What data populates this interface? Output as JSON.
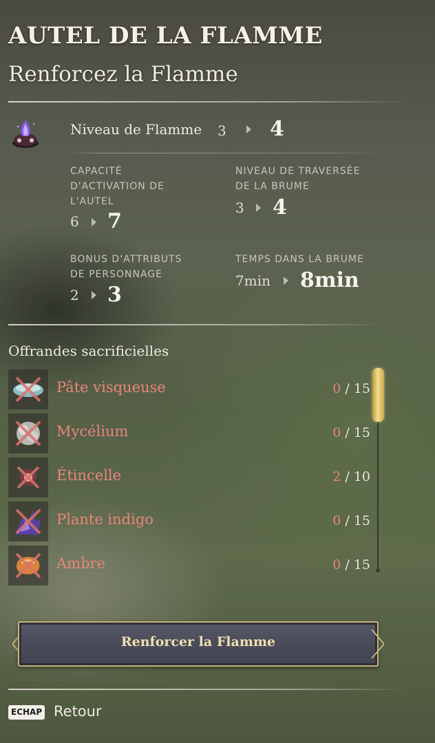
{
  "header": {
    "title": "AUTEL DE LA FLAMME",
    "subtitle": "Renforcez la Flamme"
  },
  "flame_level": {
    "label": "Niveau de Flamme",
    "old": "3",
    "new": "4",
    "icon": "flame-altar-icon"
  },
  "stats": [
    {
      "label": "CAPACITÉ\nD'ACTIVATION DE\nL'AUTEL",
      "old": "6",
      "new": "7"
    },
    {
      "label": "NIVEAU DE TRAVERSÉE\nDE LA BRUME",
      "old": "3",
      "new": "4"
    },
    {
      "label": "BONUS D'ATTRIBUTS\nDE PERSONNAGE",
      "old": "2",
      "new": "3"
    },
    {
      "label": "TEMPS DANS LA BRUME",
      "old": "7min",
      "new": "8min"
    }
  ],
  "offerings": {
    "heading": "Offrandes sacrificielles",
    "items": [
      {
        "name": "Pâte visqueuse",
        "have": "0",
        "need": "15",
        "icon": "slime-paste-icon"
      },
      {
        "name": "Mycélium",
        "have": "0",
        "need": "15",
        "icon": "mycelium-icon"
      },
      {
        "name": "Étincelle",
        "have": "2",
        "need": "10",
        "icon": "spark-icon"
      },
      {
        "name": "Plante indigo",
        "have": "0",
        "need": "15",
        "icon": "indigo-plant-icon"
      },
      {
        "name": "Ambre",
        "have": "0",
        "need": "15",
        "icon": "amber-icon"
      }
    ],
    "separator": "/"
  },
  "action_button": {
    "label": "Renforcer la Flamme"
  },
  "footer": {
    "key": "ECHAP",
    "label": "Retour"
  },
  "colors": {
    "missing_red": "#e8857d",
    "gold": "#c9b37a",
    "button_fill": "#4a4c5a"
  }
}
